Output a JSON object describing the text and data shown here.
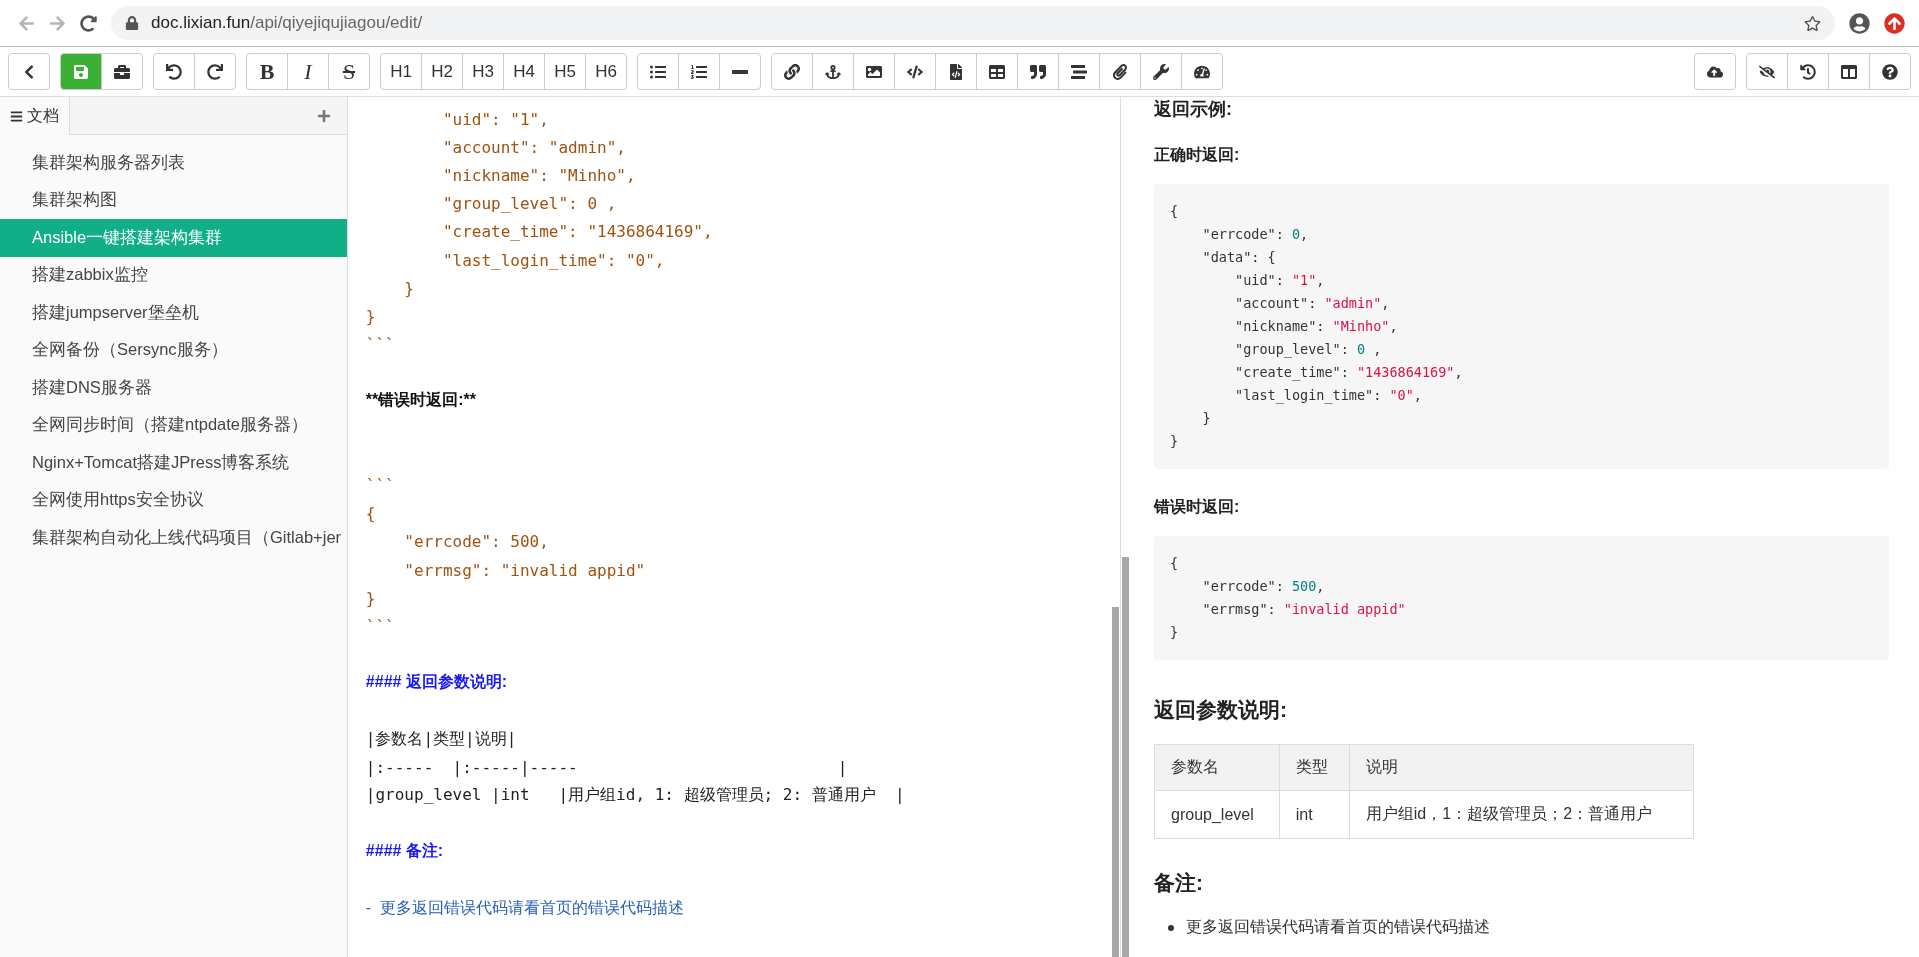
{
  "browser": {
    "host": "doc.lixian.fun",
    "path": "/api/qiyejiqujiagou/edit/"
  },
  "toolbar": {
    "left_groups": [
      [
        {
          "kind": "icon"
        }
      ],
      [
        {
          "kind": "primary-icon"
        },
        {
          "kind": "icon"
        }
      ],
      [
        {
          "kind": "icon"
        },
        {
          "kind": "icon"
        }
      ],
      [
        {
          "kind": "bold",
          "label": "B"
        },
        {
          "kind": "italic",
          "label": "I"
        },
        {
          "kind": "strike",
          "label": "S"
        }
      ],
      [
        {
          "kind": "text",
          "label": "H1"
        },
        {
          "kind": "text",
          "label": "H2"
        },
        {
          "kind": "text",
          "label": "H3"
        },
        {
          "kind": "text",
          "label": "H4"
        },
        {
          "kind": "text",
          "label": "H5"
        },
        {
          "kind": "text",
          "label": "H6"
        }
      ],
      [
        {
          "kind": "icon"
        },
        {
          "kind": "icon"
        },
        {
          "kind": "icon"
        }
      ],
      [
        {
          "kind": "icon"
        },
        {
          "kind": "icon"
        },
        {
          "kind": "icon"
        },
        {
          "kind": "icon"
        },
        {
          "kind": "icon"
        },
        {
          "kind": "icon"
        },
        {
          "kind": "icon"
        },
        {
          "kind": "icon"
        },
        {
          "kind": "icon"
        },
        {
          "kind": "icon"
        },
        {
          "kind": "icon"
        }
      ]
    ],
    "right_groups": [
      [
        {
          "kind": "icon"
        }
      ],
      [
        {
          "kind": "icon"
        },
        {
          "kind": "icon"
        },
        {
          "kind": "icon"
        },
        {
          "kind": "icon"
        }
      ]
    ]
  },
  "sidebar": {
    "tab": "文档",
    "items": [
      {
        "label": "集群架构服务器列表",
        "selected": false
      },
      {
        "label": "集群架构图",
        "selected": false
      },
      {
        "label": "Ansible一键搭建架构集群",
        "selected": true
      },
      {
        "label": "搭建zabbix监控",
        "selected": false
      },
      {
        "label": "搭建jumpserver堡垒机",
        "selected": false
      },
      {
        "label": "全网备份（Sersync服务）",
        "selected": false
      },
      {
        "label": "搭建DNS服务器",
        "selected": false
      },
      {
        "label": "全网同步时间（搭建ntpdate服务器）",
        "selected": false
      },
      {
        "label": "Nginx+Tomcat搭建JPress博客系统",
        "selected": false
      },
      {
        "label": "全网使用https安全协议",
        "selected": false
      },
      {
        "label": "集群架构自动化上线代码项目（Gitlab+jer",
        "selected": false
      }
    ]
  },
  "editor": {
    "lines": [
      {
        "kind": "code",
        "text": "        \"uid\": \"1\","
      },
      {
        "kind": "code",
        "text": "        \"account\": \"admin\","
      },
      {
        "kind": "code",
        "text": "        \"nickname\": \"Minho\","
      },
      {
        "kind": "code",
        "text": "        \"group_level\": 0 ,"
      },
      {
        "kind": "code",
        "text": "        \"create_time\": \"1436864169\","
      },
      {
        "kind": "code",
        "text": "        \"last_login_time\": \"0\","
      },
      {
        "kind": "code",
        "text": "    }"
      },
      {
        "kind": "code",
        "text": "}"
      },
      {
        "kind": "code",
        "text": "```"
      },
      {
        "kind": "blank"
      },
      {
        "kind": "bold",
        "text": "**错误时返回:**"
      },
      {
        "kind": "blank"
      },
      {
        "kind": "blank"
      },
      {
        "kind": "code",
        "text": "```"
      },
      {
        "kind": "code",
        "text": "{"
      },
      {
        "kind": "code",
        "text": "    \"errcode\": 500,"
      },
      {
        "kind": "code",
        "text": "    \"errmsg\": \"invalid appid\""
      },
      {
        "kind": "code",
        "text": "}"
      },
      {
        "kind": "code",
        "text": "```"
      },
      {
        "kind": "blank"
      },
      {
        "kind": "heading",
        "text": "#### 返回参数说明:"
      },
      {
        "kind": "blank"
      },
      {
        "kind": "table",
        "text": "|参数名|类型|说明|"
      },
      {
        "kind": "table",
        "text": "|:-----  |:-----|-----                           |"
      },
      {
        "kind": "table",
        "text": "|group_level |int   |用户组id, 1: 超级管理员; 2: 普通用户  |"
      },
      {
        "kind": "blank"
      },
      {
        "kind": "heading",
        "text": "#### 备注:"
      },
      {
        "kind": "blank"
      },
      {
        "kind": "list",
        "text": "-  更多返回错误代码请看首页的错误代码描述"
      }
    ]
  },
  "preview": {
    "blocks": [
      {
        "kind": "h4",
        "text": "返回示例:"
      },
      {
        "kind": "strong",
        "text": "正确时返回:"
      },
      {
        "kind": "code",
        "lines": [
          [
            {
              "t": "{",
              "kind": "plain"
            }
          ],
          [
            {
              "t": "    \"errcode\": ",
              "kind": "plain"
            },
            {
              "t": "0",
              "kind": "number"
            },
            {
              "t": ",",
              "kind": "plain"
            }
          ],
          [
            {
              "t": "    \"data\": {",
              "kind": "plain"
            }
          ],
          [
            {
              "t": "        \"uid\": ",
              "kind": "plain"
            },
            {
              "t": "\"1\"",
              "kind": "string"
            },
            {
              "t": ",",
              "kind": "plain"
            }
          ],
          [
            {
              "t": "        \"account\": ",
              "kind": "plain"
            },
            {
              "t": "\"admin\"",
              "kind": "string"
            },
            {
              "t": ",",
              "kind": "plain"
            }
          ],
          [
            {
              "t": "        \"nickname\": ",
              "kind": "plain"
            },
            {
              "t": "\"Minho\"",
              "kind": "string"
            },
            {
              "t": ",",
              "kind": "plain"
            }
          ],
          [
            {
              "t": "        \"group_level\": ",
              "kind": "plain"
            },
            {
              "t": "0",
              "kind": "number"
            },
            {
              "t": " ,",
              "kind": "plain"
            }
          ],
          [
            {
              "t": "        \"create_time\": ",
              "kind": "plain"
            },
            {
              "t": "\"1436864169\"",
              "kind": "string"
            },
            {
              "t": ",",
              "kind": "plain"
            }
          ],
          [
            {
              "t": "        \"last_login_time\": ",
              "kind": "plain"
            },
            {
              "t": "\"0\"",
              "kind": "string"
            },
            {
              "t": ",",
              "kind": "plain"
            }
          ],
          [
            {
              "t": "    }",
              "kind": "plain"
            }
          ],
          [
            {
              "t": "}",
              "kind": "plain"
            }
          ]
        ]
      },
      {
        "kind": "strong",
        "text": "错误时返回:"
      },
      {
        "kind": "code",
        "lines": [
          [
            {
              "t": "{",
              "kind": "plain"
            }
          ],
          [
            {
              "t": "    \"errcode\": ",
              "kind": "plain"
            },
            {
              "t": "500",
              "kind": "number"
            },
            {
              "t": ",",
              "kind": "plain"
            }
          ],
          [
            {
              "t": "    \"errmsg\": ",
              "kind": "plain"
            },
            {
              "t": "\"invalid appid\"",
              "kind": "string"
            }
          ],
          [
            {
              "t": "}",
              "kind": "plain"
            }
          ]
        ]
      },
      {
        "kind": "h3",
        "text": "返回参数说明:"
      },
      {
        "kind": "table",
        "columns": [
          "参数名",
          "类型",
          "说明"
        ],
        "rows": [
          [
            "group_level",
            "int",
            "用户组id，1：超级管理员；2：普通用户"
          ]
        ]
      },
      {
        "kind": "h3",
        "text": "备注:"
      },
      {
        "kind": "bullets",
        "items": [
          "更多返回错误代码请看首页的错误代码描述"
        ]
      }
    ]
  }
}
